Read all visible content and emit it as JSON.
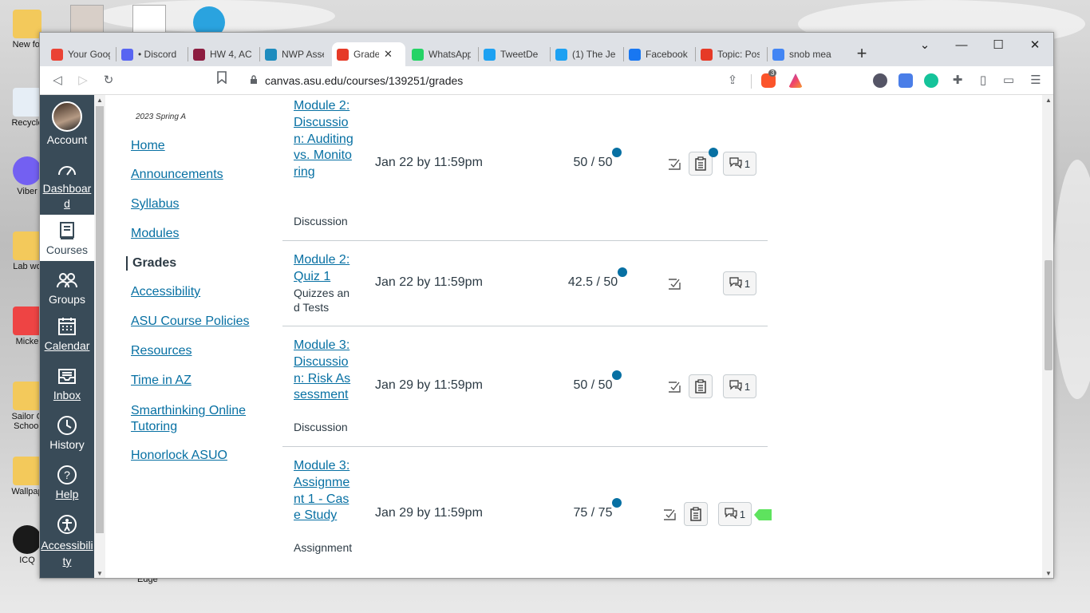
{
  "desktop": {
    "icons": [
      {
        "name": "New fol",
        "badge": "check"
      },
      {
        "name": "Recycle",
        "badge": "none"
      },
      {
        "name": "Viber",
        "badge": "check"
      },
      {
        "name": "Lab wo",
        "badge": "x"
      },
      {
        "name": "Micke",
        "badge": "x"
      },
      {
        "name": "Sailor C School",
        "badge": "check"
      },
      {
        "name": "Wallpap",
        "badge": "check"
      },
      {
        "name": "ICQ",
        "badge": "x"
      }
    ],
    "edge_label": "Edge"
  },
  "browser": {
    "tabs": [
      {
        "title": "Your Goog",
        "icon": "gmail-icon",
        "color": "#ea4335"
      },
      {
        "title": "• Discord",
        "icon": "discord-icon",
        "color": "#5865f2"
      },
      {
        "title": "HW 4, AC",
        "icon": "asu-icon",
        "color": "#8c1d40"
      },
      {
        "title": "NWP Asse",
        "icon": "wordpress-icon",
        "color": "#1e8cbe"
      },
      {
        "title": "Grades",
        "icon": "canvas-icon",
        "color": "#e63a27",
        "active": true
      },
      {
        "title": "WhatsApp",
        "icon": "whatsapp-icon",
        "color": "#25d366"
      },
      {
        "title": "TweetDe",
        "icon": "tweetdeck-icon",
        "color": "#1da1f2"
      },
      {
        "title": "(1) The Je",
        "icon": "twitter-icon",
        "color": "#1da1f2"
      },
      {
        "title": "Facebook",
        "icon": "facebook-icon",
        "color": "#1877f2"
      },
      {
        "title": "Topic: Pos",
        "icon": "canvas-icon",
        "color": "#e63a27"
      },
      {
        "title": "snob mea",
        "icon": "google-icon",
        "color": "#4285f4"
      }
    ],
    "new_tab": "+",
    "url": "canvas.asu.edu/courses/139251/grades",
    "brave_badge": "3",
    "alert_badge": "1"
  },
  "global_nav": [
    {
      "label": "Account",
      "icon": "avatar"
    },
    {
      "label": "Dashboard",
      "icon": "dashboard-icon",
      "link": true
    },
    {
      "label": "Courses",
      "icon": "courses-icon",
      "active": true
    },
    {
      "label": "Groups",
      "icon": "groups-icon"
    },
    {
      "label": "Calendar",
      "icon": "calendar-icon",
      "link": true
    },
    {
      "label": "Inbox",
      "icon": "inbox-icon",
      "link": true
    },
    {
      "label": "History",
      "icon": "history-icon"
    },
    {
      "label": "Help",
      "icon": "help-icon",
      "link": true
    },
    {
      "label": "Accessibility",
      "icon": "accessibility-icon",
      "link": true
    }
  ],
  "course_nav": {
    "term": "2023 Spring A",
    "links": [
      "Home",
      "Announcements",
      "Syllabus",
      "Modules",
      "Grades",
      "Accessibility",
      "ASU Course Policies",
      "Resources",
      "Time in AZ",
      "Smarthinking Online Tutoring",
      "Honorlock ASUO"
    ],
    "active": "Grades"
  },
  "grades": [
    {
      "name": "Module 2: Discussion: Auditing vs. Monitoring",
      "type": "Discussion",
      "due": "Jan 22 by 11:59pm",
      "score": "50 / 50",
      "rubric": true,
      "rubric_dot": true,
      "comments": "1"
    },
    {
      "name": "Module 2: Quiz 1",
      "type": "Quizzes and Tests",
      "due": "Jan 22 by 11:59pm",
      "score": "42.5 / 50",
      "rubric": false,
      "rubric_dot": false,
      "comments": "1"
    },
    {
      "name": "Module 3: Discussion: Risk Assessment",
      "type": "Discussion",
      "due": "Jan 29 by 11:59pm",
      "score": "50 / 50",
      "rubric": true,
      "rubric_dot": false,
      "comments": "1"
    },
    {
      "name": "Module 3: Assignment 1 - Case Study",
      "type": "Assignment",
      "due": "Jan 29 by 11:59pm",
      "score": "75 / 75",
      "rubric": true,
      "rubric_dot": false,
      "comments": "1"
    }
  ]
}
